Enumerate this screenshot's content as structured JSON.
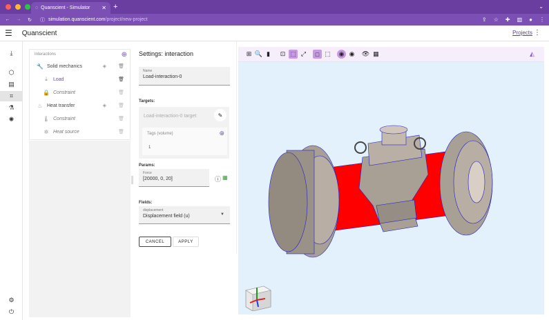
{
  "browser": {
    "tab_title": "Quanscient - Simulator",
    "url_host": "simulation.quanscient.com",
    "url_path": "/project/new-project"
  },
  "app": {
    "title": "Quanscient",
    "projects_link": "Projects"
  },
  "tree": {
    "title": "Interactions",
    "items": [
      {
        "label": "Solid mechanics",
        "icon": "wrench-icon",
        "italic": false,
        "color": "#444444"
      },
      {
        "label": "Load",
        "icon": "arrow-down-icon",
        "italic": false,
        "color": "#6b4fa8"
      },
      {
        "label": "Constraint",
        "icon": "lock-icon",
        "italic": true,
        "color": "#777777"
      },
      {
        "label": "Heat transfer",
        "icon": "heat-icon",
        "italic": false,
        "color": "#444444"
      },
      {
        "label": "Constraint",
        "icon": "thermometer-icon",
        "italic": true,
        "color": "#777777"
      },
      {
        "label": "Heat source",
        "icon": "sun-icon",
        "italic": true,
        "color": "#777777"
      }
    ]
  },
  "settings": {
    "title": "Settings: interaction",
    "name_label": "Name",
    "name_value": "Load-interaction-0",
    "targets_label": "Targets:",
    "target_placeholder": "Load-interaction-0 target",
    "tags_label": "Tags (volume)",
    "tags_value": "1",
    "params_label": "Params:",
    "force_label": "Force",
    "force_value": "[20000, 0, 20]",
    "fields_label": "Fields:",
    "displacement_label": "displacement",
    "displacement_value": "Displacement field (u)",
    "cancel_label": "CANCEL",
    "apply_label": "APPLY"
  },
  "colors": {
    "accent": "#7b4fb3",
    "highlight": "#ff0000",
    "model": "#a89f95"
  }
}
